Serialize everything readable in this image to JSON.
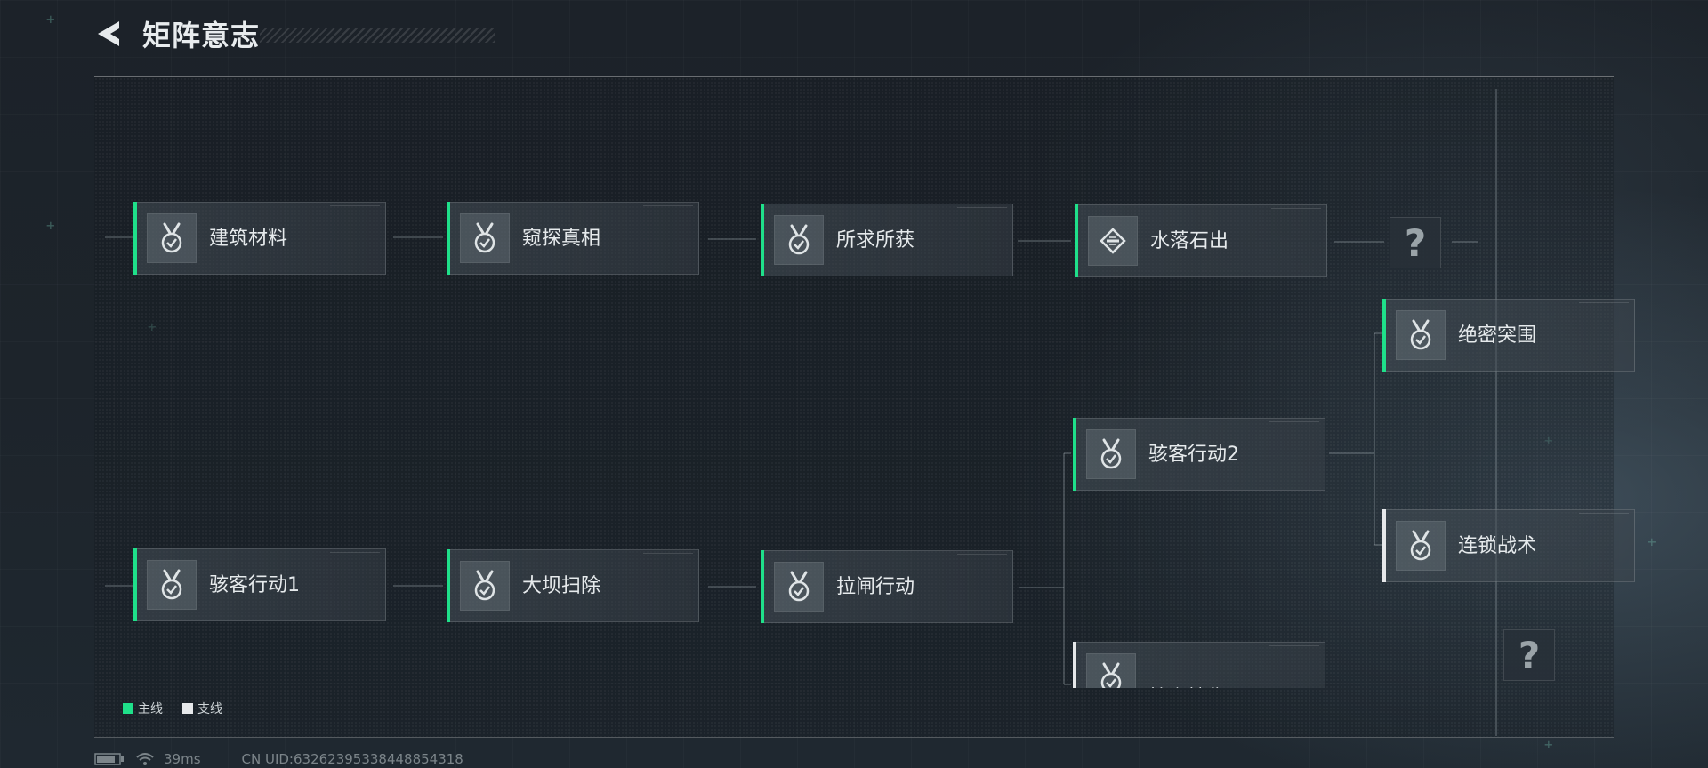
{
  "header": {
    "title": "矩阵意志"
  },
  "colors": {
    "main_accent": "#1fe08a",
    "branch_accent": "#e6e8ea"
  },
  "nodes": [
    {
      "id": "n1",
      "label": "建筑材料",
      "line": "main",
      "icon": "medal-check-icon"
    },
    {
      "id": "n2",
      "label": "窥探真相",
      "line": "main",
      "icon": "medal-check-icon"
    },
    {
      "id": "n3",
      "label": "所求所获",
      "line": "main",
      "icon": "medal-check-icon"
    },
    {
      "id": "n4",
      "label": "水落石出",
      "line": "main",
      "icon": "diamond-emblem-icon"
    },
    {
      "id": "n5",
      "label": "绝密突围",
      "line": "main",
      "icon": "medal-check-icon"
    },
    {
      "id": "n6",
      "label": "骇客行动2",
      "line": "main",
      "icon": "medal-check-icon"
    },
    {
      "id": "n7",
      "label": "连锁战术",
      "line": "branch",
      "icon": "medal-check-icon"
    },
    {
      "id": "n8",
      "label": "骇客行动1",
      "line": "main",
      "icon": "medal-check-icon"
    },
    {
      "id": "n9",
      "label": "大坝扫除",
      "line": "main",
      "icon": "medal-check-icon"
    },
    {
      "id": "n10",
      "label": "拉闸行动",
      "line": "main",
      "icon": "medal-check-icon"
    },
    {
      "id": "n11",
      "label": "档案搜集",
      "line": "branch",
      "icon": "medal-check-icon"
    }
  ],
  "unknown_nodes": [
    {
      "id": "u1",
      "label": "?"
    },
    {
      "id": "u2",
      "label": "?"
    }
  ],
  "legend": {
    "main_label": "主线",
    "branch_label": "支线"
  },
  "status": {
    "ping": "39ms",
    "uid": "CN UID:63262395338448854318"
  }
}
